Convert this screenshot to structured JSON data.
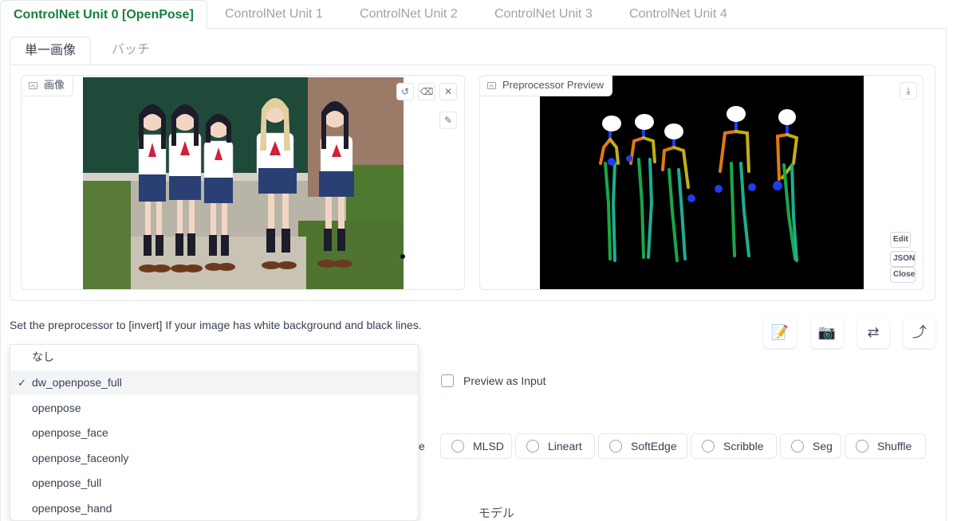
{
  "unit_tabs": [
    {
      "label": "ControlNet Unit 0 [OpenPose]"
    },
    {
      "label": "ControlNet Unit 1"
    },
    {
      "label": "ControlNet Unit 2"
    },
    {
      "label": "ControlNet Unit 3"
    },
    {
      "label": "ControlNet Unit 4"
    }
  ],
  "image_tabs": [
    {
      "label": "単一画像"
    },
    {
      "label": "バッチ"
    }
  ],
  "input_image": {
    "label": "画像",
    "tools": [
      "undo-icon",
      "eraser-icon",
      "close-icon",
      "brush-icon"
    ]
  },
  "preview": {
    "label": "Preprocessor Preview",
    "buttons": {
      "edit": "Edit",
      "json": "JSON",
      "close": "Close"
    }
  },
  "hint_text": "Set the preprocessor to [invert] If your image has white background and black lines.",
  "action_icons": [
    "memo-icon",
    "camera-icon",
    "swap-icon",
    "arrow-curve-icon"
  ],
  "preview_as_input": "Preview as Input",
  "control_types": {
    "partial_visible": "se",
    "items": [
      "MLSD",
      "Lineart",
      "SoftEdge",
      "Scribble",
      "Seg",
      "Shuffle"
    ]
  },
  "model_label": "モデル",
  "preprocessor_dropdown": {
    "selected": "dw_openpose_full",
    "check_glyph": "✓",
    "options": [
      "なし",
      "dw_openpose_full",
      "openpose",
      "openpose_face",
      "openpose_faceonly",
      "openpose_full",
      "openpose_hand"
    ]
  },
  "colors": {
    "accent": "#15803d",
    "border": "#e5e7eb",
    "muted_text": "#9ca3af"
  }
}
